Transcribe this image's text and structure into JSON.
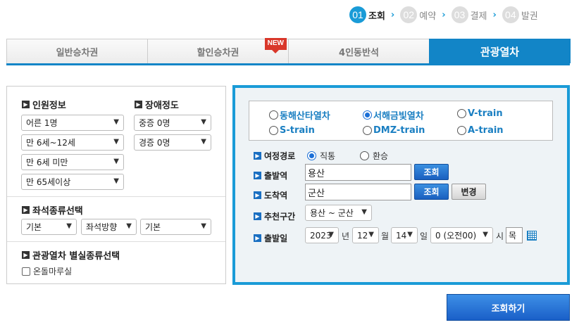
{
  "steps": [
    {
      "num": "01",
      "label": "조회",
      "active": true
    },
    {
      "num": "02",
      "label": "예약"
    },
    {
      "num": "03",
      "label": "결제"
    },
    {
      "num": "04",
      "label": "발권"
    }
  ],
  "tabs": [
    "일반승차권",
    "할인승차권",
    "4인동반석",
    "관광열차"
  ],
  "new_badge": "NEW",
  "passengers": {
    "title": "인원정보",
    "adult": "어른 1명",
    "child": "만 6세~12세",
    "infant": "만 6세 미만",
    "senior": "만 65세이상"
  },
  "disability": {
    "title": "장애정도",
    "severe": "중증 0명",
    "mild": "경증 0명"
  },
  "seat_type": {
    "title": "좌석종류선택",
    "type": "기본",
    "direction": "좌석방향",
    "position": "기본"
  },
  "special_room": {
    "title": "관광열차 별실종류선택",
    "option": "온돌마루실"
  },
  "trains": [
    "동해산타열차",
    "서해금빛열차",
    "V-train",
    "S-train",
    "DMZ-train",
    "A-train"
  ],
  "selected_train": "서해금빛열차",
  "route": {
    "label": "여정경로",
    "direct": "직통",
    "transfer": "환승"
  },
  "departure": {
    "label": "출발역",
    "value": "용산",
    "button": "조회"
  },
  "arrival": {
    "label": "도착역",
    "value": "군산",
    "button": "조회",
    "swap": "변경"
  },
  "recommended": {
    "label": "추천구간",
    "value": "용산 ~ 군산"
  },
  "date": {
    "label": "출발일",
    "year": "2023",
    "year_unit": "년",
    "month": "12",
    "month_unit": "월",
    "day": "14",
    "day_unit": "일",
    "hour": "0 (오전00)",
    "hour_unit": "시",
    "weekday": "목"
  },
  "search_button": "조회하기",
  "colors": {
    "accent": "#1a9bd7",
    "tab_active": "#1285c7",
    "badge": "#d9372a"
  }
}
